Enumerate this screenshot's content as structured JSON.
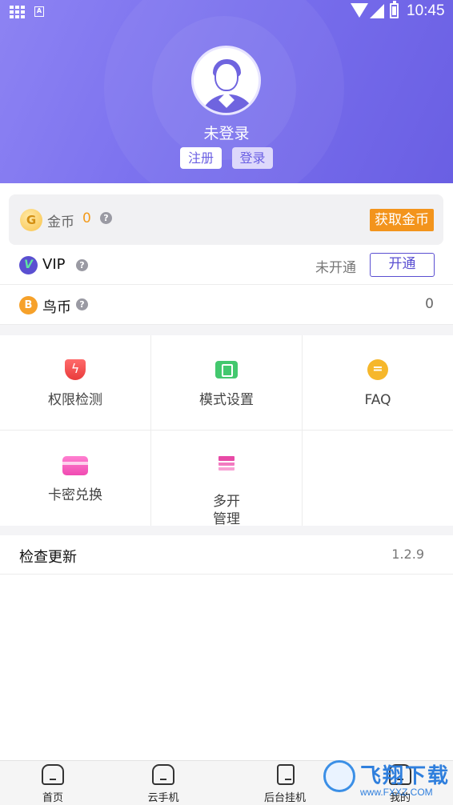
{
  "status_bar": {
    "time": "10:45",
    "notification_icon": "A"
  },
  "profile": {
    "login_status": "未登录",
    "register_label": "注册",
    "login_label": "登录"
  },
  "coins": {
    "icon_letter": "G",
    "label": "金币",
    "value": "0",
    "help": "?",
    "get_button": "获取金币"
  },
  "vip": {
    "badge": "V",
    "label": "VIP",
    "help": "?",
    "status": "未开通",
    "open_button": "开通"
  },
  "bird_coin": {
    "icon_letter": "B",
    "label": "鸟币",
    "help": "?",
    "value": "0"
  },
  "grid": {
    "items": [
      {
        "label": "权限检测",
        "icon": "shield-icon"
      },
      {
        "label": "模式设置",
        "icon": "mode-icon"
      },
      {
        "label": "FAQ",
        "icon": "faq-chat-icon"
      },
      {
        "label": "卡密兑换",
        "icon": "card-icon"
      },
      {
        "label": "多开\n管理",
        "line1": "多开",
        "line2": "管理",
        "icon": "layers-icon"
      }
    ]
  },
  "update": {
    "label": "检查更新",
    "version": "1.2.9"
  },
  "bottom_nav": {
    "items": [
      {
        "label": "首页",
        "icon": "home-icon"
      },
      {
        "label": "云手机",
        "icon": "cloud-phone-icon"
      },
      {
        "label": "后台挂机",
        "icon": "phone-icon"
      },
      {
        "label": "我的",
        "icon": "profile-icon"
      }
    ]
  },
  "watermark": {
    "text": "飞翔下载",
    "url": "www.FXXZ.COM"
  },
  "colors": {
    "header_gradient_start": "#8d83f3",
    "header_gradient_end": "#6a5fe3",
    "accent_purple": "#5a4fd1",
    "coin_orange": "#f3941c"
  }
}
